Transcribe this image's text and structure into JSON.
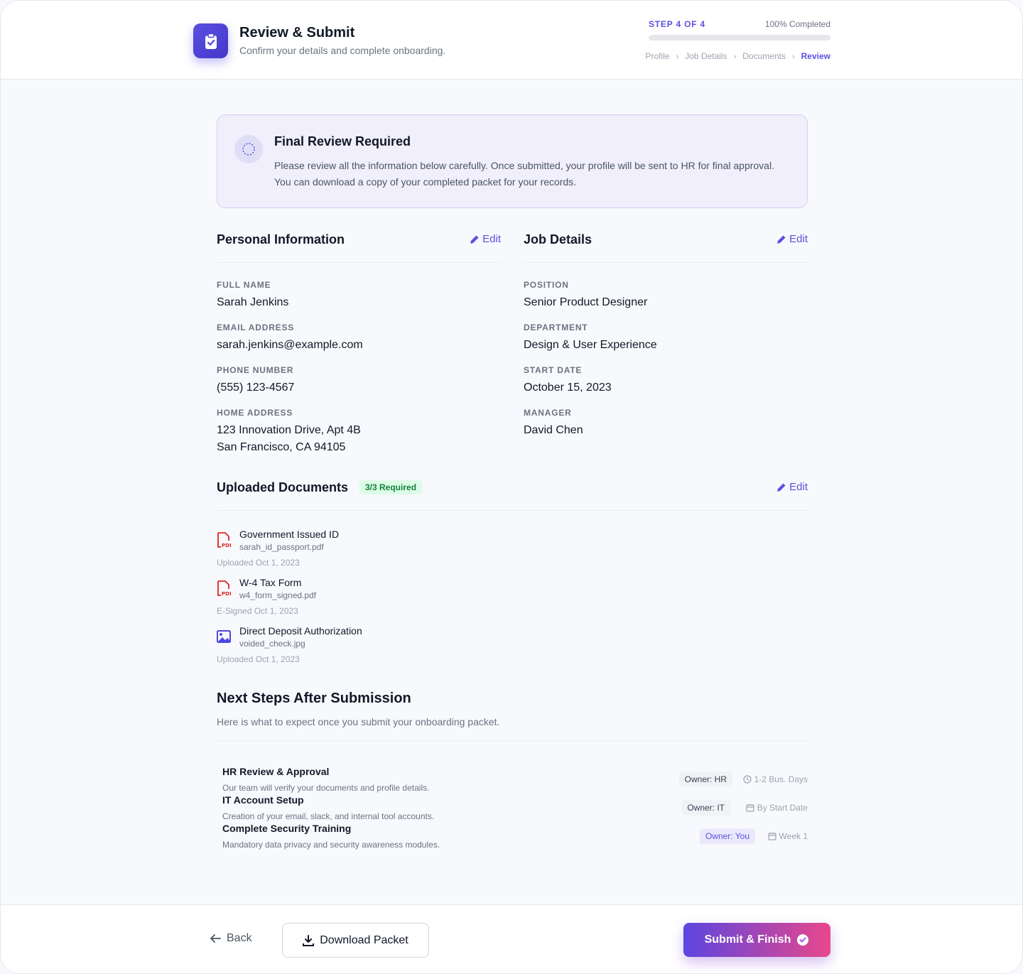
{
  "header": {
    "title": "Review & Submit",
    "subtitle": "Confirm your details and complete onboarding.",
    "step_label": "STEP 4 OF 4",
    "completed_label": "100% Completed",
    "progress_percent": 100,
    "breadcrumb": [
      "Profile",
      "Job Details",
      "Documents",
      "Review"
    ]
  },
  "notice": {
    "title": "Final Review Required",
    "body": "Please review all the information below carefully. Once submitted, your profile will be sent to HR for final approval. You can download a copy of your completed packet for your records."
  },
  "personal": {
    "title": "Personal Information",
    "edit_label": "Edit",
    "fields": [
      {
        "label": "FULL NAME",
        "value": "Sarah Jenkins"
      },
      {
        "label": "EMAIL ADDRESS",
        "value": "sarah.jenkins@example.com"
      },
      {
        "label": "PHONE NUMBER",
        "value": "(555) 123-4567"
      },
      {
        "label": "HOME ADDRESS",
        "value": "123 Innovation Drive, Apt 4B",
        "value2": "San Francisco, CA 94105"
      }
    ]
  },
  "job": {
    "title": "Job Details",
    "edit_label": "Edit",
    "fields": [
      {
        "label": "POSITION",
        "value": "Senior Product Designer"
      },
      {
        "label": "DEPARTMENT",
        "value": "Design & User Experience"
      },
      {
        "label": "START DATE",
        "value": "October 15, 2023"
      },
      {
        "label": "MANAGER",
        "value": "David Chen"
      }
    ]
  },
  "documents": {
    "title": "Uploaded Documents",
    "badge": "3/3 Required",
    "edit_label": "Edit",
    "items": [
      {
        "name": "Government Issued ID",
        "file": "sarah_id_passport.pdf",
        "date": "Uploaded Oct 1, 2023",
        "icon": "pdf-icon"
      },
      {
        "name": "W-4 Tax Form",
        "file": "w4_form_signed.pdf",
        "date": "E-Signed Oct 1, 2023",
        "icon": "pdf-icon"
      },
      {
        "name": "Direct Deposit Authorization",
        "file": "voided_check.jpg",
        "date": "Uploaded Oct 1, 2023",
        "icon": "image-icon"
      }
    ]
  },
  "next_steps": {
    "title": "Next Steps After Submission",
    "subtitle": "Here is what to expect once you submit your onboarding packet.",
    "items": [
      {
        "name": "HR Review & Approval",
        "desc": "Our team will verify your documents and profile details.",
        "owner": "Owner: HR",
        "eta": "1-2 Bus. Days",
        "eta_icon": "clock-icon"
      },
      {
        "name": "IT Account Setup",
        "desc": "Creation of your email, slack, and internal tool accounts.",
        "owner": "Owner: IT",
        "eta": "By Start Date",
        "eta_icon": "calendar-icon"
      },
      {
        "name": "Complete Security Training",
        "desc": "Mandatory data privacy and security awareness modules.",
        "owner": "Owner: You",
        "eta": "Week 1",
        "eta_icon": "calendar-icon"
      }
    ]
  },
  "footer": {
    "back_label": "Back",
    "download_label": "Download Packet",
    "submit_label": "Submit & Finish"
  },
  "colors": {
    "accent": "#5b4fe0",
    "submit_gradient_start": "#5b46e0",
    "submit_gradient_end": "#e8478c",
    "success_badge": "#dcfce7"
  }
}
